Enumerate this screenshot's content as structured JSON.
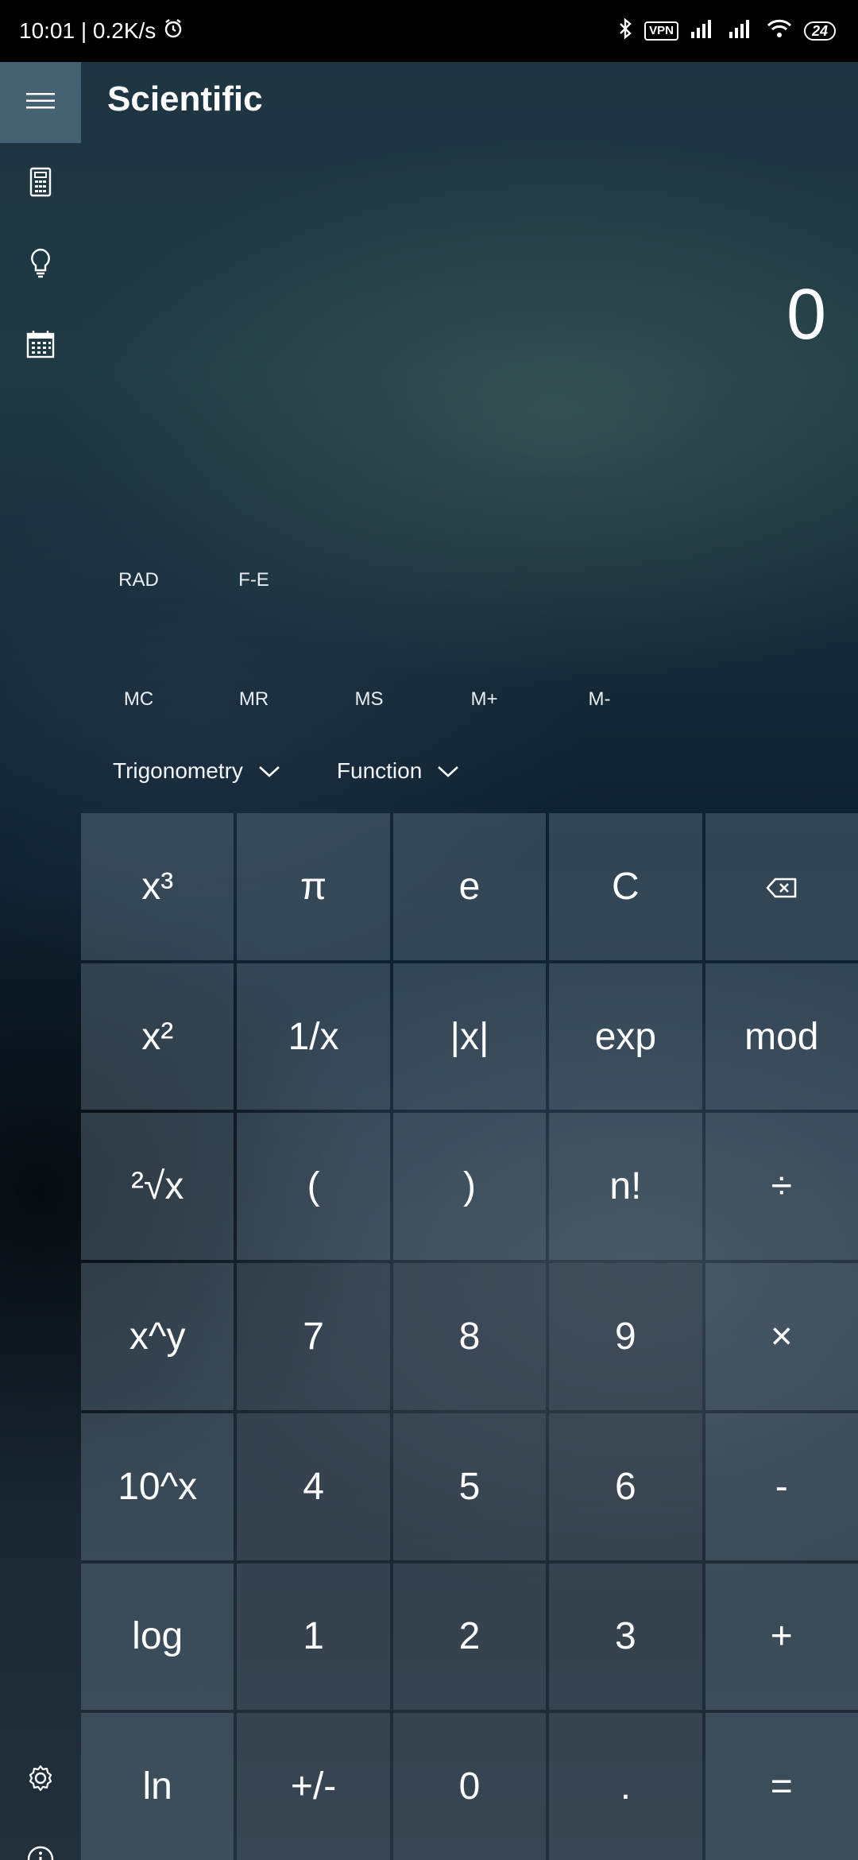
{
  "status_bar": {
    "time_speed": "10:01 | 0.2K/s",
    "vpn": "VPN",
    "battery": "24",
    "icons": [
      "alarm-icon",
      "bluetooth-icon",
      "signal-icon",
      "signal-icon",
      "wifi-icon"
    ]
  },
  "header": {
    "title": "Scientific"
  },
  "display": {
    "value": "0"
  },
  "modes": {
    "angle": "RAD",
    "notation": "F-E"
  },
  "memory": [
    "MC",
    "MR",
    "MS",
    "M+",
    "M-"
  ],
  "dropdowns": {
    "trig": "Trigonometry",
    "func": "Function"
  },
  "keys": [
    [
      "x³",
      "π",
      "e",
      "C",
      "backspace"
    ],
    [
      "x²",
      "1/x",
      "|x|",
      "exp",
      "mod"
    ],
    [
      "²√x",
      "(",
      ")",
      "n!",
      "÷"
    ],
    [
      "x^y",
      "7",
      "8",
      "9",
      "×"
    ],
    [
      "10^x",
      "4",
      "5",
      "6",
      "-"
    ],
    [
      "log",
      "1",
      "2",
      "3",
      "+"
    ],
    [
      "ln",
      "+/-",
      "0",
      ".",
      "="
    ]
  ],
  "rail_icons": [
    "menu-icon",
    "calculator-icon",
    "lightbulb-icon",
    "calendar-icon",
    "settings-icon",
    "info-icon"
  ]
}
